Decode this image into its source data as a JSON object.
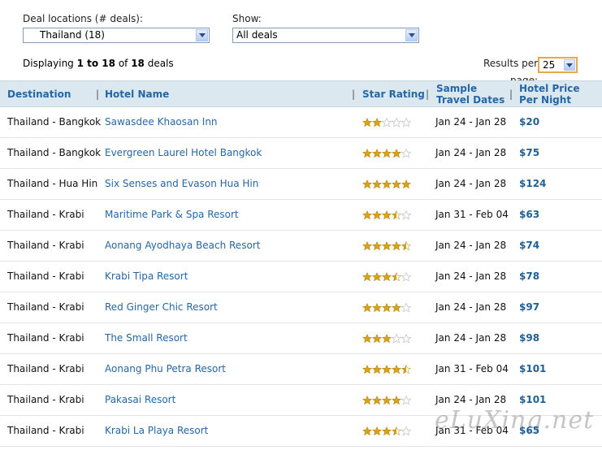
{
  "filters": {
    "deal_locations_label": "Deal locations (# deals):",
    "deal_locations_value": "Thailand (18)",
    "show_label": "Show:",
    "show_value": "All deals"
  },
  "summary": {
    "prefix": "Displaying ",
    "range": "1 to 18",
    "of": " of ",
    "total": "18",
    "suffix": " deals"
  },
  "results_per_page": {
    "label_line1": "Results per",
    "label_line2": "page:",
    "value": "25"
  },
  "table": {
    "headers": {
      "destination": "Destination",
      "hotel": "Hotel Name",
      "stars": "Star Rating",
      "dates_line1": "Sample",
      "dates_line2": "Travel Dates",
      "price_line1": "Hotel Price",
      "price_line2": "Per Night"
    },
    "rows": [
      {
        "destination": "Thailand - Bangkok",
        "hotel": "Sawasdee Khaosan Inn",
        "stars": 2,
        "dates": "Jan 24 - Jan 28",
        "price": "$20"
      },
      {
        "destination": "Thailand - Bangkok",
        "hotel": "Evergreen Laurel Hotel Bangkok",
        "stars": 4,
        "dates": "Jan 24 - Jan 28",
        "price": "$75"
      },
      {
        "destination": "Thailand - Hua Hin",
        "hotel": "Six Senses and Evason Hua Hin",
        "stars": 5,
        "dates": "Jan 24 - Jan 28",
        "price": "$124"
      },
      {
        "destination": "Thailand - Krabi",
        "hotel": "Maritime Park & Spa Resort",
        "stars": 3.5,
        "dates": "Jan 31 - Feb 04",
        "price": "$63"
      },
      {
        "destination": "Thailand - Krabi",
        "hotel": "Aonang Ayodhaya Beach Resort",
        "stars": 4.5,
        "dates": "Jan 24 - Jan 28",
        "price": "$74"
      },
      {
        "destination": "Thailand - Krabi",
        "hotel": "Krabi Tipa Resort",
        "stars": 3.5,
        "dates": "Jan 24 - Jan 28",
        "price": "$78"
      },
      {
        "destination": "Thailand - Krabi",
        "hotel": "Red Ginger Chic Resort",
        "stars": 4,
        "dates": "Jan 24 - Jan 28",
        "price": "$97"
      },
      {
        "destination": "Thailand - Krabi",
        "hotel": "The Small Resort",
        "stars": 3,
        "dates": "Jan 24 - Jan 28",
        "price": "$98"
      },
      {
        "destination": "Thailand - Krabi",
        "hotel": "Aonang Phu Petra Resort",
        "stars": 4.5,
        "dates": "Jan 31 - Feb 04",
        "price": "$101"
      },
      {
        "destination": "Thailand - Krabi",
        "hotel": "Pakasai Resort",
        "stars": 4,
        "dates": "Jan 24 - Jan 28",
        "price": "$101"
      },
      {
        "destination": "Thailand - Krabi",
        "hotel": "Krabi La Playa Resort",
        "stars": 3.5,
        "dates": "Jan 31 - Feb 04",
        "price": "$65"
      }
    ]
  },
  "watermark": "eLuXing.net",
  "colors": {
    "link": "#2467a7",
    "header_bg": "#dce8ef",
    "star_fill": "#d9a21b",
    "star_empty": "#c7c7c7"
  },
  "icons": {
    "select_arrow": "chevron-down-icon",
    "star": "star-icon"
  }
}
